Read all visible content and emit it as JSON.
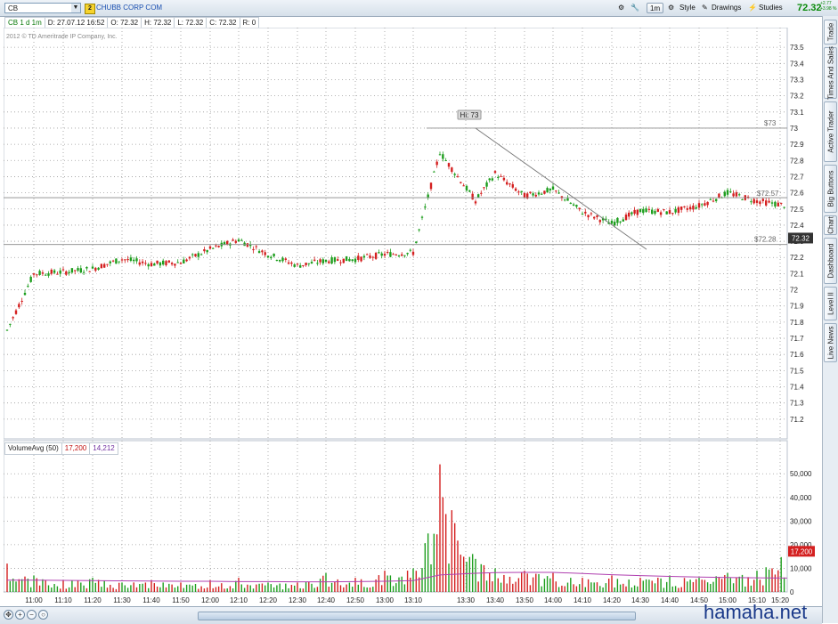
{
  "toolbar": {
    "symbol": "CB",
    "link_badge": "2",
    "company": "CHUBB CORP COM",
    "timeframe": "1m",
    "style_label": "Style",
    "drawings_label": "Drawings",
    "studies_label": "Studies",
    "last_price": "72.32",
    "change_top": "+2.77",
    "change_bottom": "+3.98 %"
  },
  "infobar": {
    "title": "CB 1 d 1m",
    "date": "D: 27.07.12 16:52",
    "open": "O: 72.32",
    "high": "H: 72.32",
    "low": "L: 72.32",
    "close": "C: 72.32",
    "range": "R: 0"
  },
  "copyright": "2012 © TD Ameritrade IP Company, Inc.",
  "volume_panel": {
    "name": "VolumeAvg (50)",
    "value1": "17,200",
    "value2": "14,212"
  },
  "side_tabs": [
    "Trade",
    "Times And Sales",
    "Active Trader",
    "Big Buttons",
    "Chart",
    "Dashboard",
    "Level II",
    "Live News"
  ],
  "colors": {
    "up": "#1e9e1e",
    "down": "#d42020",
    "grid": "#9a9a9a",
    "avg_line": "#b040b0",
    "accent": "#0a8a0a"
  },
  "watermark": "hamaha.net",
  "chart_data": [
    {
      "type": "candlestick",
      "title": "CB 1 d 1m",
      "x": [
        "11:00",
        "11:10",
        "11:20",
        "11:30",
        "11:40",
        "11:50",
        "12:00",
        "12:10",
        "12:20",
        "12:30",
        "12:40",
        "12:50",
        "13:00",
        "13:10",
        "13:20",
        "13:30",
        "13:40",
        "13:50",
        "14:00",
        "14:10",
        "14:20",
        "14:30",
        "14:40",
        "14:50",
        "15:00",
        "15:10",
        "15:20",
        "15:23"
      ],
      "series": [
        {
          "close": [
            71.75,
            72.1,
            72.11,
            72.13,
            72.19,
            72.16,
            72.17,
            72.25,
            72.31,
            72.22,
            72.15,
            72.18,
            72.19,
            72.22,
            72.23,
            72.85,
            72.55,
            72.72,
            72.58,
            72.62,
            72.48,
            72.41,
            72.49,
            72.48,
            72.52,
            72.6,
            72.55,
            72.52
          ]
        }
      ],
      "ylim": [
        71.1,
        73.6
      ],
      "yticks": [
        "73.5",
        "73.4",
        "73.3",
        "73.2",
        "73.1",
        "73",
        "72.9",
        "72.8",
        "72.7",
        "72.6",
        "72.5",
        "72.4",
        "72.3",
        "72.2",
        "72.1",
        "72",
        "71.9",
        "71.8",
        "71.7",
        "71.6",
        "71.5",
        "71.4",
        "71.3",
        "71.2"
      ],
      "xticks": [
        "11:00",
        "11:10",
        "11:20",
        "11:30",
        "11:40",
        "11:50",
        "12:00",
        "12:10",
        "12:20",
        "12:30",
        "12:40",
        "12:50",
        "13:00",
        "13:10",
        "13:30",
        "13:40",
        "13:50",
        "14:00",
        "14:10",
        "14:20",
        "14:30",
        "14:40",
        "14:50",
        "15:00",
        "15:10",
        "15:20"
      ],
      "annotations": [
        {
          "text": "Hi: 73"
        },
        {
          "text": "$73",
          "y": 73
        },
        {
          "text": "$72.57",
          "y": 72.57
        },
        {
          "text": "$72.28",
          "y": 72.28
        },
        {
          "text": "72.32",
          "y": 72.32
        }
      ],
      "grid": true
    },
    {
      "type": "bar",
      "title": "VolumeAvg (50)",
      "x": [
        "11:00",
        "11:10",
        "11:20",
        "11:30",
        "11:40",
        "11:50",
        "12:00",
        "12:10",
        "12:20",
        "12:30",
        "12:40",
        "12:50",
        "13:00",
        "13:10",
        "13:20",
        "13:30",
        "13:40",
        "13:50",
        "14:00",
        "14:10",
        "14:20",
        "14:30",
        "14:40",
        "14:50",
        "15:00",
        "15:10",
        "15:20",
        "15:23"
      ],
      "values": [
        12000,
        7000,
        5000,
        6000,
        4000,
        5000,
        4000,
        5000,
        6000,
        4000,
        4000,
        8000,
        6000,
        9000,
        10000,
        54000,
        14000,
        10000,
        9000,
        8000,
        6000,
        7000,
        6000,
        7000,
        6000,
        8000,
        9000,
        17200
      ],
      "avg": [
        5000,
        5000,
        4900,
        4800,
        4700,
        4600,
        4500,
        4500,
        4400,
        4400,
        4300,
        4300,
        4400,
        4500,
        4800,
        7200,
        7900,
        8200,
        8300,
        8300,
        7800,
        7300,
        6900,
        6600,
        6300,
        6100,
        6000,
        5900
      ],
      "ylim": [
        0,
        58000
      ],
      "yticks": [
        "50,000",
        "40,000",
        "30,000",
        "20,000",
        "10,000",
        "0"
      ],
      "annotations": [
        {
          "text": "17,200",
          "y": 17200
        }
      ],
      "grid": true
    }
  ]
}
